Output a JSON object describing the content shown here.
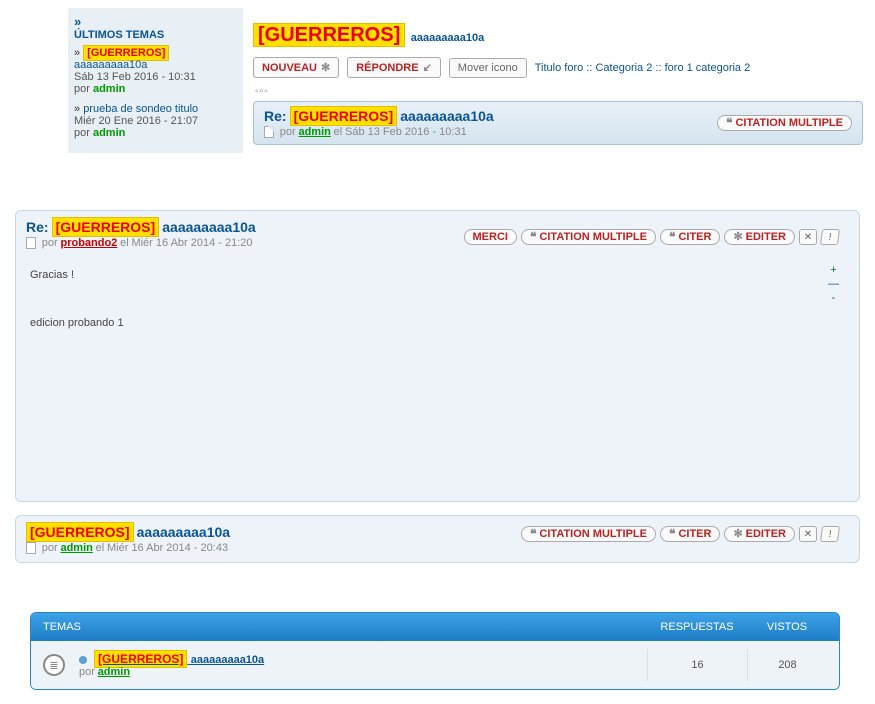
{
  "sidebar": {
    "header": "ÚLTIMOS TEMAS",
    "items": [
      {
        "prefix": "»",
        "tag": "[GUERREROS]",
        "title": "aaaaaaaaa10a",
        "date": "Sáb 13 Feb 2016 - 10:31",
        "por": "por",
        "user": "admin"
      },
      {
        "prefix": "»",
        "title": "prueba de sondeo titulo",
        "date": "Miér 20 Ene 2016 - 21:07",
        "por": "por",
        "user": "admin"
      }
    ]
  },
  "thread": {
    "tag": "[GUERREROS]",
    "title": "aaaaaaaaa10a"
  },
  "buttons": {
    "nouveau": "NOUVEAU",
    "repondre": "RÉPONDRE",
    "mover": "Mover icono"
  },
  "breadcrumb": {
    "p1": "Titulo foro",
    "sep": "::",
    "p2": "Categoria 2",
    "p3": "foro 1 categoria 2"
  },
  "post_a": {
    "re": "Re:",
    "tag": "[GUERREROS]",
    "title": "aaaaaaaaa10a",
    "por": "por",
    "user": "admin",
    "on": "el",
    "date": "Sáb 13 Feb 2016 - 10:31",
    "citation": "CITATION MULTIPLE"
  },
  "post_b": {
    "re": "Re:",
    "tag": "[GUERREROS]",
    "title": "aaaaaaaaa10a",
    "por": "por",
    "user": "probando2",
    "on": "el",
    "date": "Miér 16 Abr 2014 - 21:20",
    "merci": "MERCI",
    "citation": "CITATION MULTIPLE",
    "citer": "CITER",
    "editer": "EDITER",
    "body_line1": "Gracias !",
    "body_line2": "edicion probando 1"
  },
  "post_c": {
    "tag": "[GUERREROS]",
    "title": "aaaaaaaaa10a",
    "por": "por",
    "user": "admin",
    "on": "el",
    "date": "Miér 16 Abr 2014 - 20:43",
    "citation": "CITATION MULTIPLE",
    "citer": "CITER",
    "editer": "EDITER"
  },
  "table": {
    "head_temas": "TEMAS",
    "head_resp": "RESPUESTAS",
    "head_vistos": "VISTOS",
    "row": {
      "tag": "[GUERREROS]",
      "title": "aaaaaaaaa10a",
      "por": "por",
      "user": "admin",
      "resp": "16",
      "vistos": "208"
    }
  }
}
